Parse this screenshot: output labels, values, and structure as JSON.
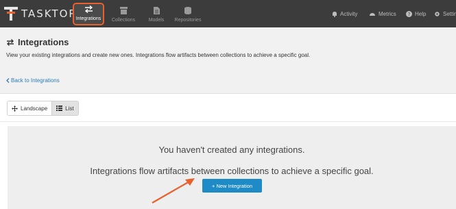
{
  "app": {
    "logo_text": "TASKTOP",
    "nav_tabs": [
      {
        "label": "Integrations",
        "icon": "arrows-swap-icon",
        "active": true
      },
      {
        "label": "Collections",
        "icon": "box-icon",
        "active": false
      },
      {
        "label": "Models",
        "icon": "document-icon",
        "active": false
      },
      {
        "label": "Repositories",
        "icon": "database-icon",
        "active": false
      }
    ],
    "right_nav": [
      {
        "label": "Activity",
        "icon": "bell-icon"
      },
      {
        "label": "Metrics",
        "icon": "gauge-icon"
      },
      {
        "label": "Help",
        "icon": "question-icon"
      },
      {
        "label": "Setting",
        "icon": "gear-icon"
      }
    ],
    "accent_color": "#e8602c",
    "link_color": "#2b7bb9",
    "button_color": "#1e8bc7"
  },
  "header": {
    "title": "Integrations",
    "description": "View your existing integrations and create new ones. Integrations flow artifacts between collections to achieve a specific goal."
  },
  "back": {
    "label": "Back to Integrations"
  },
  "view_toggle": {
    "landscape_label": "Landscape",
    "list_label": "List",
    "selected": "List"
  },
  "empty_state": {
    "title": "You haven't created any integrations.",
    "subtitle": "Integrations flow artifacts between collections to achieve a specific goal.",
    "button_label": "+ New Integration"
  }
}
